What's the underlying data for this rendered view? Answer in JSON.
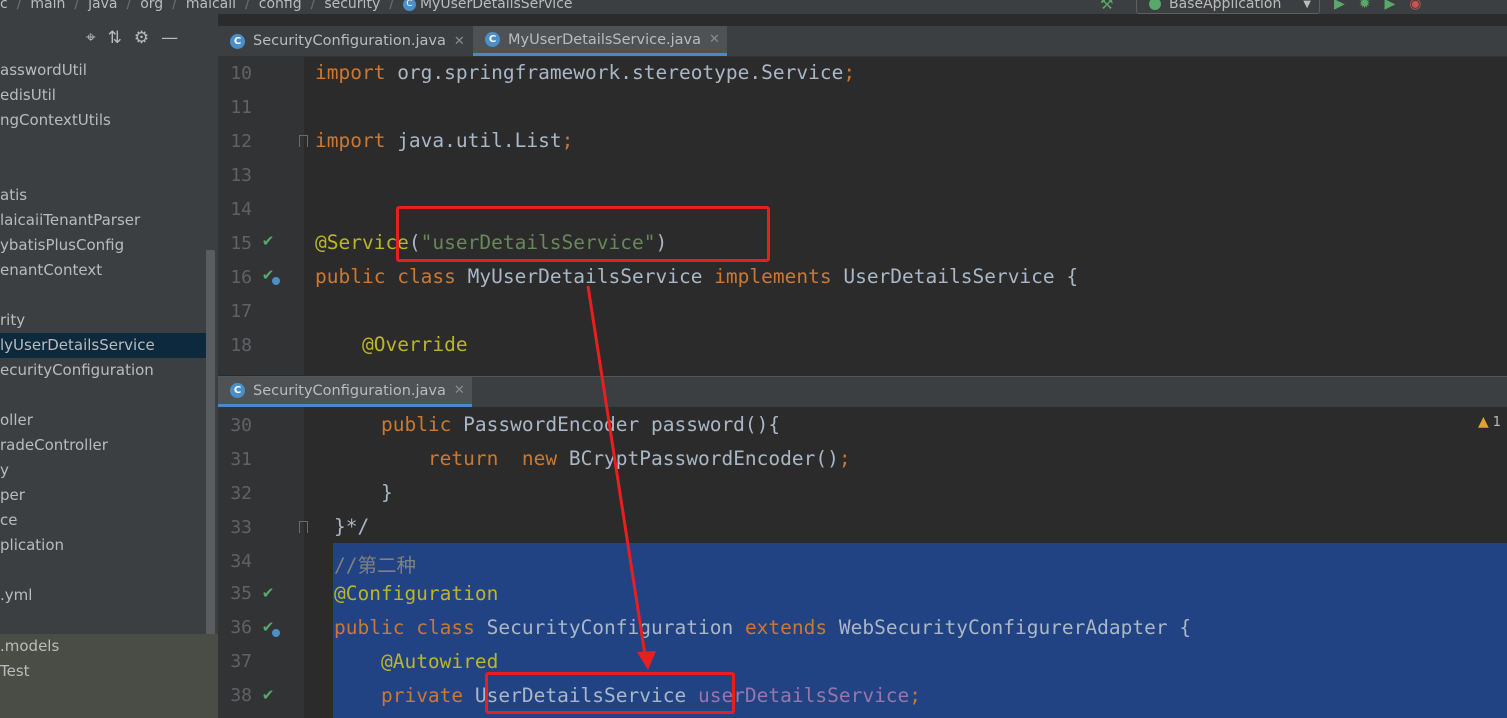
{
  "breadcrumb": [
    "c",
    "main",
    "java",
    "org",
    "maicaii",
    "config",
    "security",
    "MyUserDetailsService"
  ],
  "run_config": {
    "label": "BaseApplication"
  },
  "sidebar": {
    "toolbar_icons": [
      "target-icon",
      "collapse-icon",
      "gear-icon",
      "minimize-icon"
    ],
    "items": [
      "asswordUtil",
      "edisUtil",
      "ngContextUtils",
      "",
      "",
      "atis",
      "laicaiiTenantParser",
      "ybatisPlusConfig",
      "enantContext",
      "",
      "rity",
      "lyUserDetailsService",
      "ecurityConfiguration",
      "",
      "oller",
      "radeController",
      "y",
      "per",
      "ce",
      "plication",
      "",
      ".yml"
    ],
    "selected_index": 11,
    "bottom_items": [
      ".models",
      "Test"
    ]
  },
  "tabs_top": [
    {
      "label": "SecurityConfiguration.java",
      "active": false
    },
    {
      "label": "MyUserDetailsService.java",
      "active": true
    }
  ],
  "tabs_bottom": [
    {
      "label": "SecurityConfiguration.java",
      "active": true
    }
  ],
  "warning_count": "1",
  "top_pane": {
    "lines": [
      {
        "n": "10",
        "code": "import org.springframework.stereotype.Service;"
      },
      {
        "n": "11",
        "code": ""
      },
      {
        "n": "12",
        "code": "import java.util.List;"
      },
      {
        "n": "13",
        "code": ""
      },
      {
        "n": "14",
        "code": ""
      },
      {
        "n": "15",
        "code": "@Service(\"userDetailsService\")"
      },
      {
        "n": "16",
        "code": "public class MyUserDetailsService implements UserDetailsService {"
      },
      {
        "n": "17",
        "code": ""
      },
      {
        "n": "18",
        "code": "    @Override"
      }
    ]
  },
  "bottom_pane": {
    "lines": [
      {
        "n": "30",
        "code": "    public PasswordEncoder password(){"
      },
      {
        "n": "31",
        "code": "        return  new BCryptPasswordEncoder();"
      },
      {
        "n": "32",
        "code": "    }"
      },
      {
        "n": "33",
        "code": "}*/"
      },
      {
        "n": "34",
        "code": "//第二种"
      },
      {
        "n": "35",
        "code": "@Configuration"
      },
      {
        "n": "36",
        "code": "public class SecurityConfiguration extends WebSecurityConfigurerAdapter {"
      },
      {
        "n": "37",
        "code": "    @Autowired"
      },
      {
        "n": "38",
        "code": "    private UserDetailsService userDetailsService;"
      }
    ]
  },
  "colors": {
    "keyword": "#cc7832",
    "annotation": "#bbb529",
    "string": "#6a8759",
    "selection": "#214283",
    "highlight_box": "#e81f1f"
  }
}
